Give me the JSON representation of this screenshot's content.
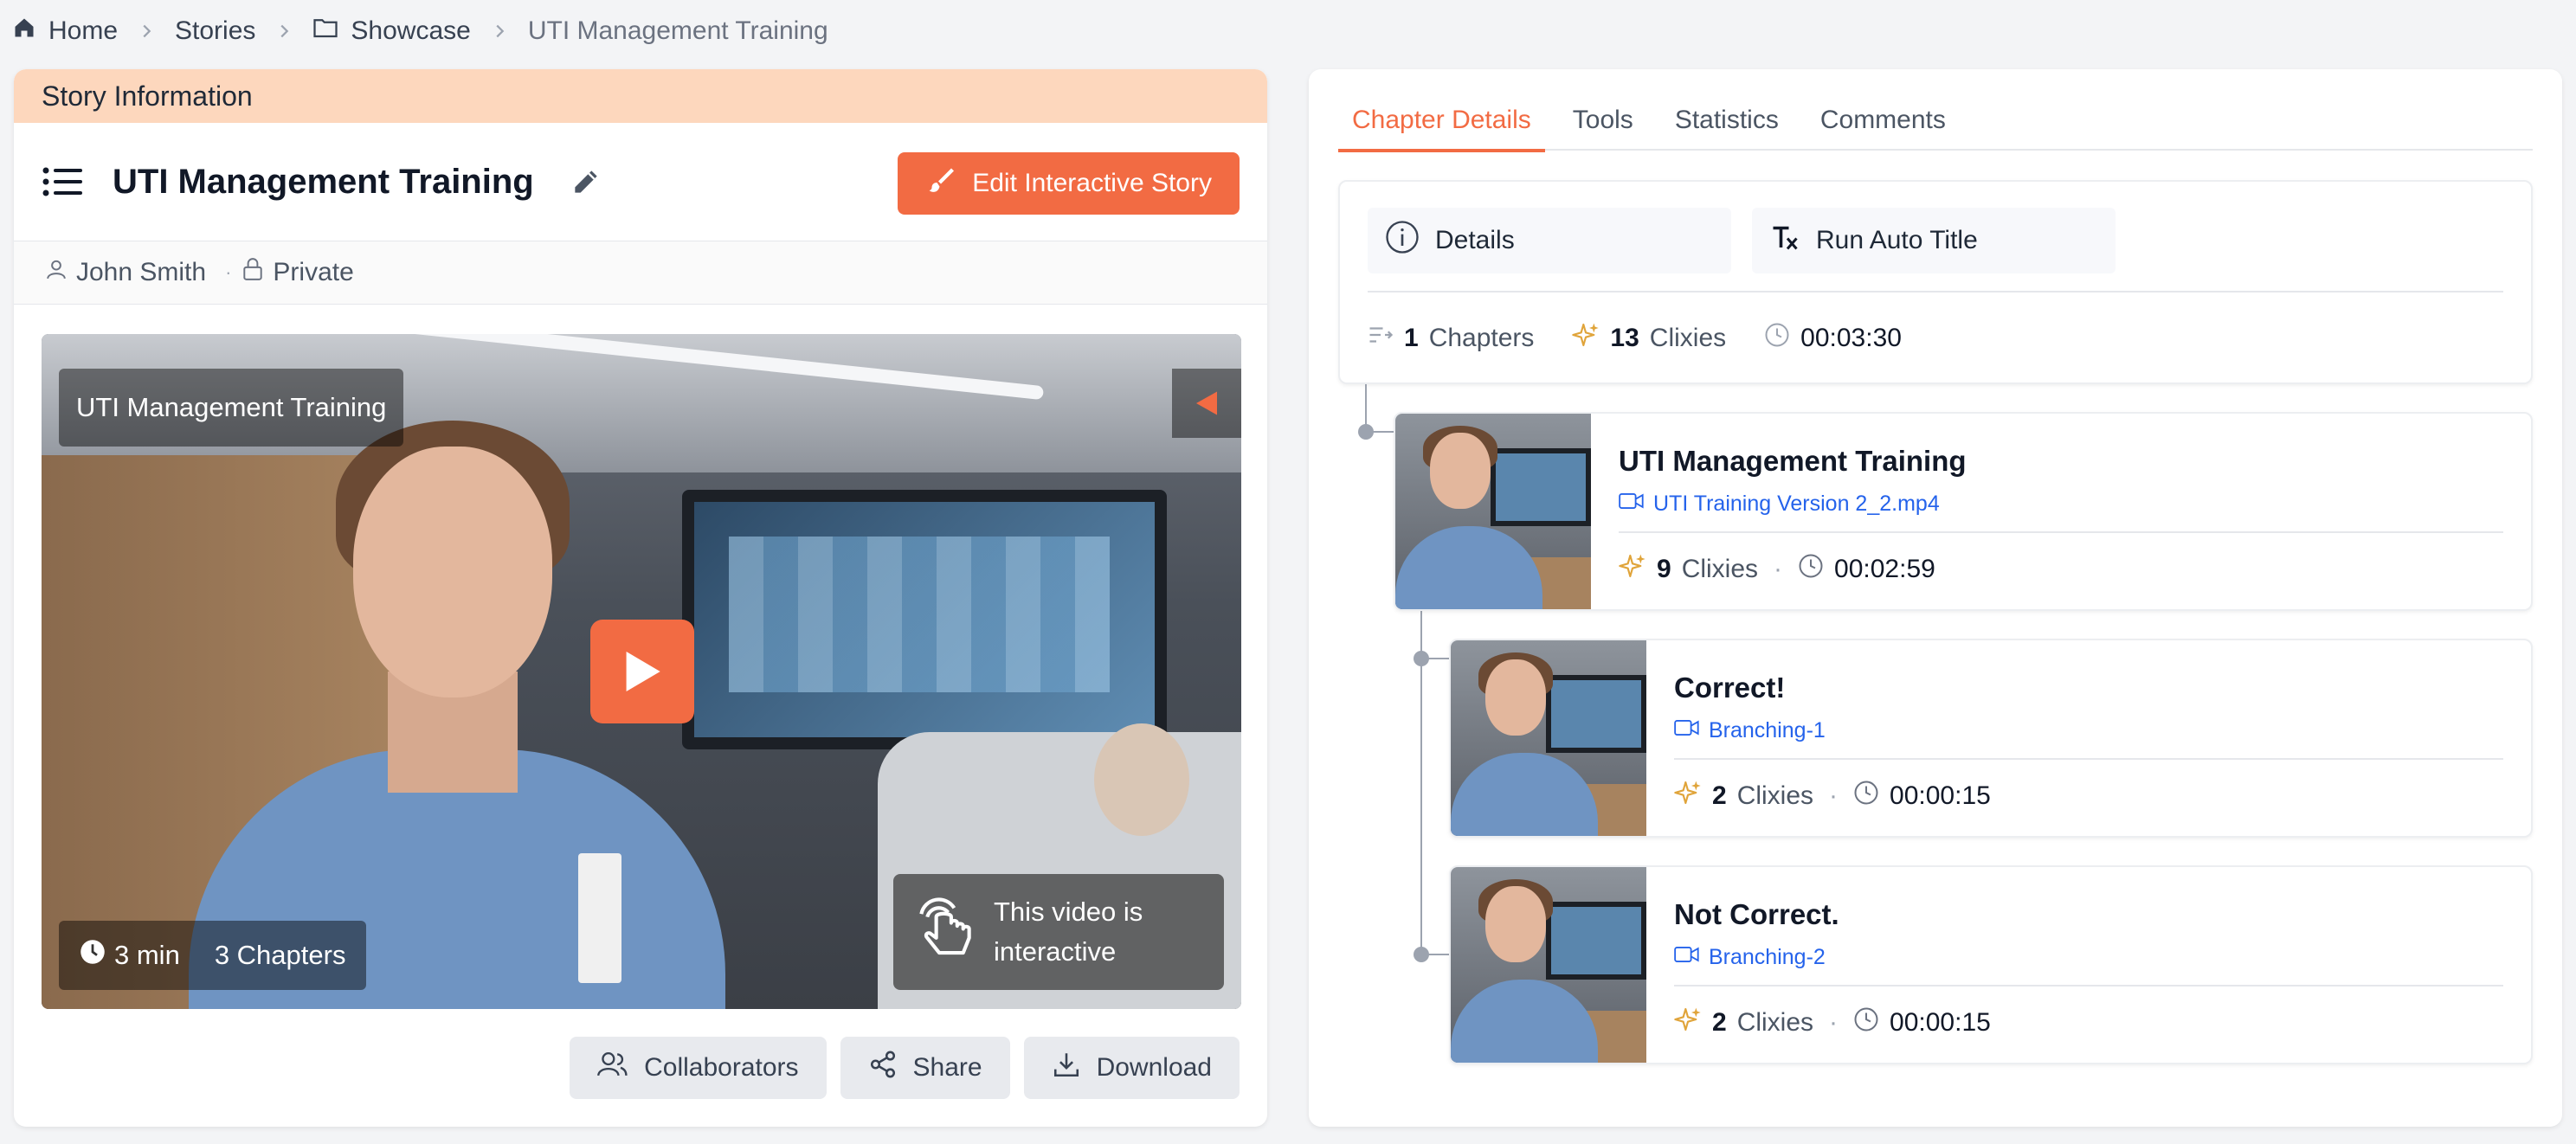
{
  "breadcrumb": {
    "home": "Home",
    "stories": "Stories",
    "showcase": "Showcase",
    "current": "UTI Management Training"
  },
  "story": {
    "section_header": "Story Information",
    "title": "UTI Management Training",
    "edit_button": "Edit Interactive Story",
    "author": "John Smith",
    "visibility": "Private",
    "video": {
      "title_overlay": "UTI Management Training",
      "duration": "3 min",
      "chapters": "3 Chapters",
      "interactive_text": "This video is interactive"
    },
    "actions": {
      "collaborators": "Collaborators",
      "share": "Share",
      "download": "Download"
    }
  },
  "tabs": [
    {
      "label": "Chapter Details",
      "active": true
    },
    {
      "label": "Tools",
      "active": false
    },
    {
      "label": "Statistics",
      "active": false
    },
    {
      "label": "Comments",
      "active": false
    }
  ],
  "summary": {
    "details_button": "Details",
    "auto_title_button": "Run Auto Title",
    "chapters_count": "1",
    "chapters_label": "Chapters",
    "clixies_count": "13",
    "clixies_label": "Clixies",
    "duration": "00:03:30"
  },
  "chapters": [
    {
      "title": "UTI Management Training",
      "file": "UTI Training Version 2_2.mp4",
      "clixies_count": "9",
      "clixies_label": "Clixies",
      "duration": "00:02:59"
    },
    {
      "title": "Correct!",
      "file": "Branching-1",
      "clixies_count": "2",
      "clixies_label": "Clixies",
      "duration": "00:00:15"
    },
    {
      "title": "Not Correct.",
      "file": "Branching-2",
      "clixies_count": "2",
      "clixies_label": "Clixies",
      "duration": "00:00:15"
    }
  ],
  "colors": {
    "accent": "#f26b43",
    "header_bg": "#fdd7bd",
    "link": "#2563eb",
    "clixie_icon": "#e0a43a"
  }
}
